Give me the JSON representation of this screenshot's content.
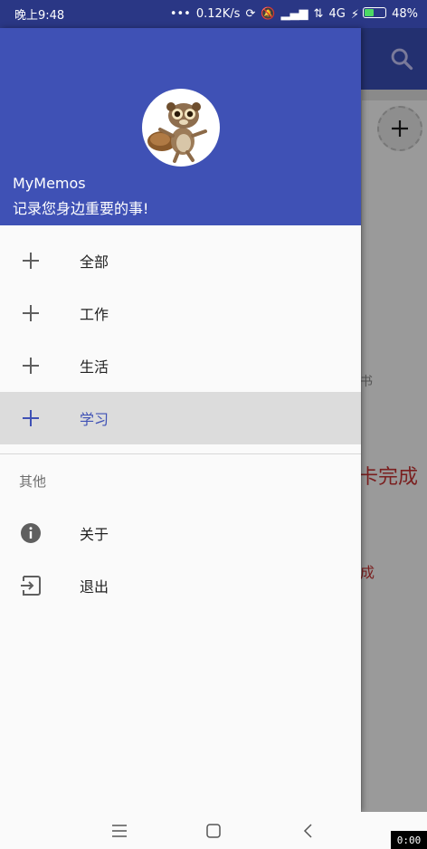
{
  "status_bar": {
    "time": "晚上9:48",
    "net_speed": "0.12K/s",
    "network": "4G",
    "battery": "48%",
    "battery_level": 0.48
  },
  "background_app": {
    "fab_icon": "plus-icon",
    "text_partial_1": "卡完成",
    "text_partial_2": "成",
    "text_partial_0": "书"
  },
  "drawer": {
    "header": {
      "app_name": "MyMemos",
      "tagline": "记录您身边重要的事!"
    },
    "items": [
      {
        "label": "全部",
        "icon": "plus-icon"
      },
      {
        "label": "工作",
        "icon": "plus-icon"
      },
      {
        "label": "生活",
        "icon": "plus-icon"
      },
      {
        "label": "学习",
        "icon": "plus-icon",
        "active": true
      }
    ],
    "subheader": "其他",
    "other_items": [
      {
        "label": "关于",
        "icon": "info-icon"
      },
      {
        "label": "退出",
        "icon": "exit-icon"
      }
    ]
  },
  "nav_bar": {
    "recorder": "0:00"
  },
  "colors": {
    "primary": "#3f51b5",
    "status_bar": "#2a3785",
    "active_bg": "#dcdcdc"
  }
}
